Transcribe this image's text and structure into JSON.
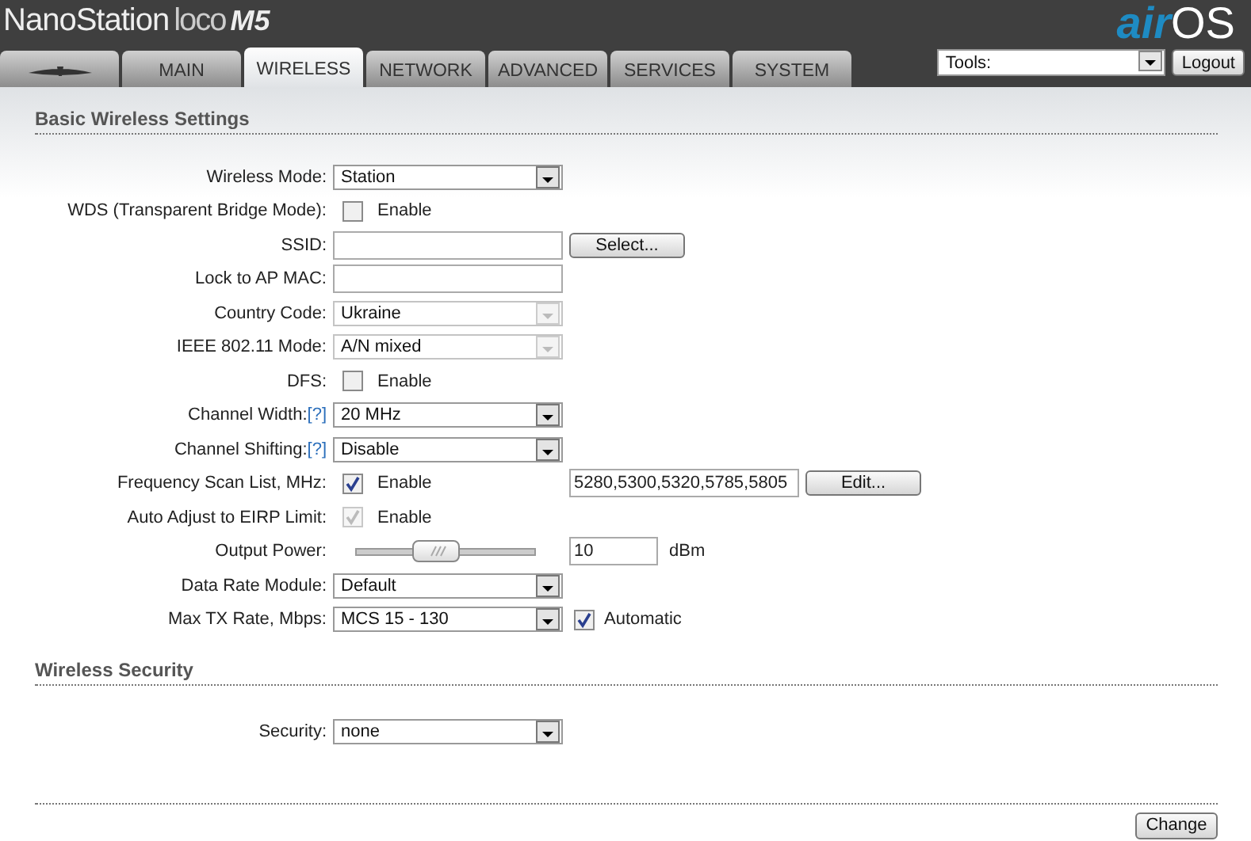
{
  "header": {
    "product": "NanoStation",
    "product_line": "loco",
    "model": "M5",
    "brand_prefix": "air",
    "brand_suffix": "OS"
  },
  "tabs": [
    {
      "kind": "icon",
      "selected": false
    },
    {
      "kind": "text",
      "label": "MAIN",
      "selected": false
    },
    {
      "kind": "text",
      "label": "WIRELESS",
      "selected": true
    },
    {
      "kind": "text",
      "label": "NETWORK",
      "selected": false
    },
    {
      "kind": "text",
      "label": "ADVANCED",
      "selected": false
    },
    {
      "kind": "text",
      "label": "SERVICES",
      "selected": false
    },
    {
      "kind": "text",
      "label": "SYSTEM",
      "selected": false
    }
  ],
  "tools": {
    "value": "Tools:"
  },
  "logout_button": "Logout",
  "sections": [
    {
      "title": "Basic Wireless Settings",
      "rows": [
        {
          "label": "Wireless Mode:",
          "controls": [
            {
              "kind": "select",
              "value": "Station",
              "disabled": false
            }
          ]
        },
        {
          "label": "WDS (Transparent Bridge Mode):",
          "controls": [
            {
              "kind": "checkbox",
              "label": "Enable",
              "checked": false,
              "disabled": false
            }
          ]
        },
        {
          "label": "SSID:",
          "controls": [
            {
              "kind": "input"
            },
            {
              "kind": "button",
              "label": "Select..."
            }
          ]
        },
        {
          "label": "Lock to AP MAC:",
          "controls": [
            {
              "kind": "input"
            }
          ]
        },
        {
          "label": "Country Code:",
          "controls": [
            {
              "kind": "select",
              "value": "Ukraine",
              "disabled": true
            }
          ]
        },
        {
          "label": "IEEE 802.11 Mode:",
          "controls": [
            {
              "kind": "select",
              "value": "A/N mixed",
              "disabled": true
            }
          ]
        },
        {
          "label": "DFS:",
          "controls": [
            {
              "kind": "checkbox",
              "label": "Enable",
              "checked": false,
              "disabled": false
            }
          ]
        },
        {
          "label": "Channel Width:",
          "help": "[?]",
          "controls": [
            {
              "kind": "select",
              "value": "20 MHz",
              "disabled": false
            }
          ]
        },
        {
          "label": "Channel Shifting:",
          "help": "[?]",
          "controls": [
            {
              "kind": "select",
              "value": "Disable",
              "disabled": false
            }
          ]
        },
        {
          "label": "Frequency Scan List, MHz:",
          "controls": [
            {
              "kind": "checkbox",
              "label": "Enable",
              "checked": true,
              "disabled": false
            },
            {
              "kind": "input",
              "value": "5280,5300,5320,5785,5805"
            },
            {
              "kind": "button",
              "label": "Edit..."
            }
          ]
        },
        {
          "label": "Auto Adjust to EIRP Limit:",
          "controls": [
            {
              "kind": "checkbox",
              "label": "Enable",
              "checked": true,
              "disabled": true
            }
          ]
        },
        {
          "label": "Output Power:",
          "controls": [
            {
              "kind": "slider",
              "level": 0.45
            },
            {
              "kind": "input",
              "value": "10"
            },
            {
              "kind": "unit",
              "label": "dBm"
            }
          ]
        },
        {
          "label": "Data Rate Module:",
          "controls": [
            {
              "kind": "select",
              "value": "Default",
              "disabled": false
            }
          ]
        },
        {
          "label": "Max TX Rate, Mbps:",
          "controls": [
            {
              "kind": "select",
              "value": "MCS 15 - 130",
              "disabled": false
            },
            {
              "kind": "checkbox",
              "label": "Automatic",
              "checked": true,
              "disabled": false
            }
          ]
        }
      ]
    },
    {
      "title": "Wireless Security",
      "rows": [
        {
          "label": "Security:",
          "controls": [
            {
              "kind": "select",
              "value": "none",
              "disabled": false
            }
          ]
        }
      ]
    }
  ],
  "change_button": "Change"
}
